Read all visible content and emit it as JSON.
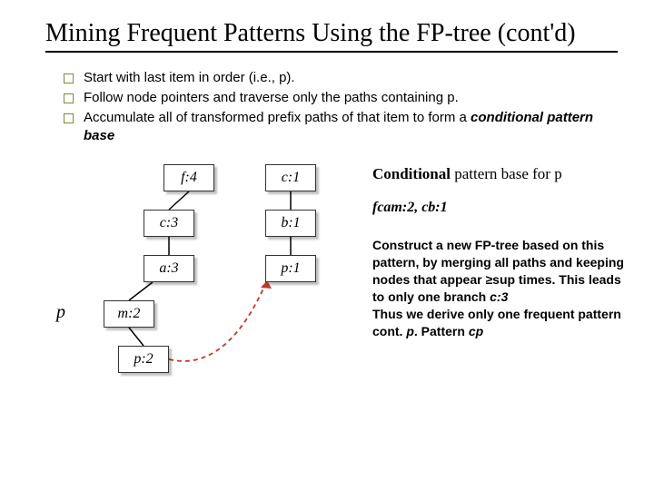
{
  "title": "Mining Frequent Patterns Using the FP-tree (cont'd)",
  "bullets": [
    "Start with last item in order (i.e., p).",
    "Follow node pointers and traverse only the paths containing p.",
    "Accumulate all of transformed prefix paths of that item to form a "
  ],
  "bullet3_emph": "conditional pattern base",
  "nodes": {
    "f4": "f:4",
    "c1": "c:1",
    "c3": "c:3",
    "b1": "b:1",
    "a3": "a:3",
    "p1": "p:1",
    "m2": "m:2",
    "p2": "p:2"
  },
  "plabel": "p",
  "right": {
    "cpb_title_bold": "Conditional",
    "cpb_title_rest": " pattern base for p",
    "cpb_value": "fcam:2, cb:1",
    "construct_1": "Construct a new FP-tree based on this pattern, by merging all paths and keeping nodes that appear ",
    "construct_geq": "≥",
    "construct_sup": "sup",
    "construct_2": " times. This leads to only one branch ",
    "construct_branch": "c:3",
    "construct_3": "Thus we derive only one frequent pattern cont. ",
    "construct_p": "p",
    "construct_pattern_lbl": ". Pattern ",
    "construct_cp": "cp"
  }
}
